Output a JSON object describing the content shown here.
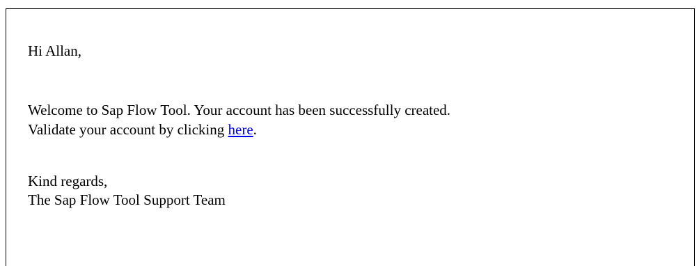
{
  "email": {
    "greeting": "Hi Allan,",
    "welcome": "Welcome to Sap Flow Tool. Your account has been successfully created.",
    "validate_prefix": "Validate your account by clicking ",
    "validate_link": "here",
    "validate_suffix": ".",
    "closing": "Kind regards,",
    "signature": "The Sap Flow Tool Support Team"
  },
  "colors": {
    "text": "#000000",
    "link": "#0000ee",
    "border": "#000000",
    "background": "#ffffff"
  }
}
